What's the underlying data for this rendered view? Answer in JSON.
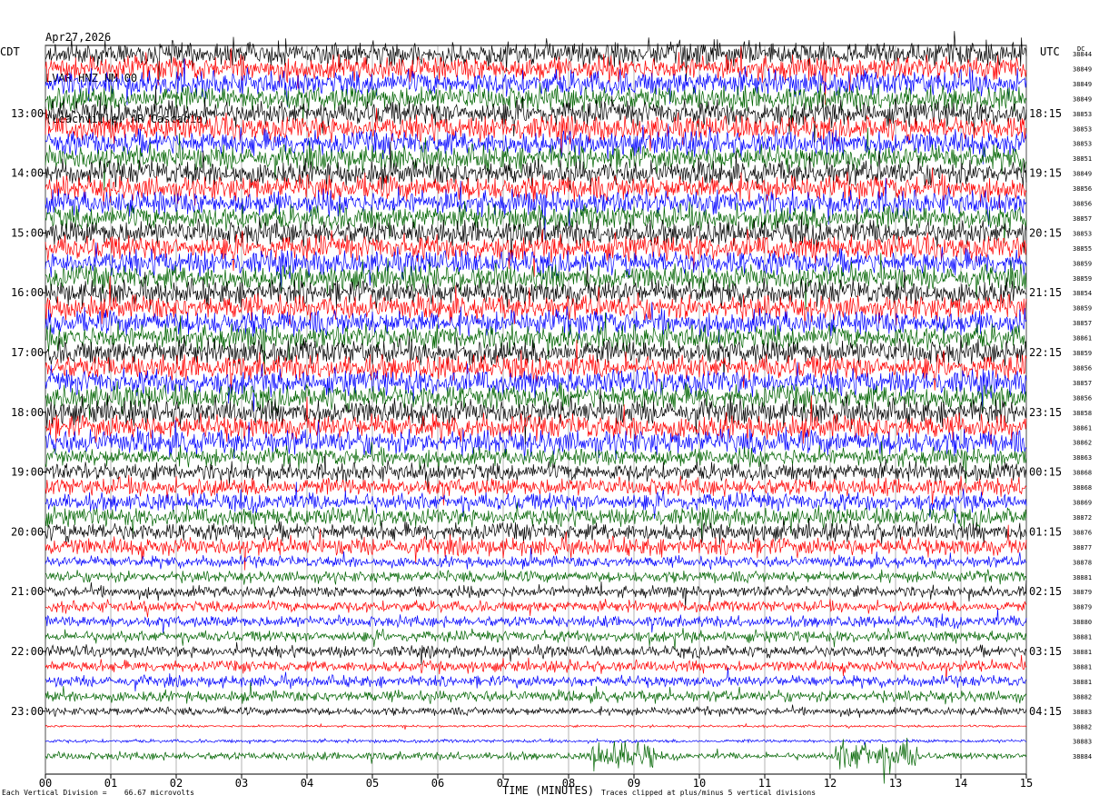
{
  "header": {
    "date": "Apr27,2026",
    "station": "LVAR HNZ NM 00",
    "location": "(Leachville, AR Cascadia)"
  },
  "left_tz": "CDT",
  "right_tz": "UTC",
  "dc_label": "DC",
  "footer": {
    "left": "Each Vertical Division =    66.67 microvolts",
    "right": "Traces clipped at plus/minus 5 vertical divisions"
  },
  "colors": {
    "trace_cycle": [
      "#000000",
      "#ff0000",
      "#0000ff",
      "#006400"
    ],
    "grid": "#808080"
  },
  "chart_data": {
    "type": "line",
    "title": "LVAR HNZ NM 00",
    "xlabel": "TIME (MINUTES)",
    "xlim": [
      0,
      15
    ],
    "x_ticks": [
      "00",
      "01",
      "02",
      "03",
      "04",
      "05",
      "06",
      "07",
      "08",
      "09",
      "10",
      "11",
      "12",
      "13",
      "14",
      "15"
    ],
    "left_hour_labels": [
      {
        "row": 4,
        "label": "13:00"
      },
      {
        "row": 8,
        "label": "14:00"
      },
      {
        "row": 12,
        "label": "15:00"
      },
      {
        "row": 16,
        "label": "16:00"
      },
      {
        "row": 20,
        "label": "17:00"
      },
      {
        "row": 24,
        "label": "18:00"
      },
      {
        "row": 28,
        "label": "19:00"
      },
      {
        "row": 32,
        "label": "20:00"
      },
      {
        "row": 36,
        "label": "21:00"
      },
      {
        "row": 40,
        "label": "22:00"
      },
      {
        "row": 44,
        "label": "23:00"
      }
    ],
    "right_hour_labels": [
      {
        "row": 4,
        "label": "18:15"
      },
      {
        "row": 8,
        "label": "19:15"
      },
      {
        "row": 12,
        "label": "20:15"
      },
      {
        "row": 16,
        "label": "21:15"
      },
      {
        "row": 20,
        "label": "22:15"
      },
      {
        "row": 24,
        "label": "23:15"
      },
      {
        "row": 28,
        "label": "00:15"
      },
      {
        "row": 32,
        "label": "01:15"
      },
      {
        "row": 36,
        "label": "02:15"
      },
      {
        "row": 40,
        "label": "03:15"
      },
      {
        "row": 44,
        "label": "04:15"
      }
    ],
    "dc_offsets": [
      "38844",
      "38849",
      "38849",
      "38849",
      "38853",
      "38853",
      "38853",
      "38851",
      "38849",
      "38856",
      "38856",
      "38857",
      "38853",
      "38855",
      "38859",
      "38859",
      "38854",
      "38859",
      "38857",
      "38861",
      "38859",
      "38856",
      "38857",
      "38856",
      "38858",
      "38861",
      "38862",
      "38863",
      "38868",
      "38868",
      "38869",
      "38872",
      "38876",
      "38877",
      "38878",
      "38881",
      "38879",
      "38879",
      "38880",
      "38881",
      "38881",
      "38881",
      "38881",
      "38882",
      "38883",
      "38882",
      "38883",
      "38884"
    ],
    "series": [
      {
        "traces": 48,
        "color_cycle": [
          "black",
          "red",
          "blue",
          "green"
        ]
      }
    ]
  }
}
